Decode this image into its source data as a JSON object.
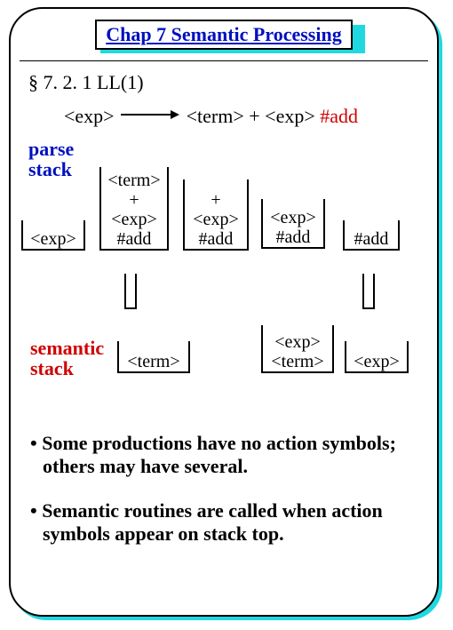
{
  "title": "Chap 7  Semantic Processing",
  "section": "§ 7. 2. 1   LL(1)",
  "production": {
    "lhs": "<exp>",
    "rhs_term": "<term>",
    "rhs_plus": "+",
    "rhs_exp": "<exp>",
    "rhs_action": " #add"
  },
  "labels": {
    "parse_stack_line1": "parse",
    "parse_stack_line2": "stack",
    "semantic_stack_line1": "semantic",
    "semantic_stack_line2": "stack"
  },
  "parse_stacks": {
    "s1": [
      "<exp>"
    ],
    "s2": [
      "<term>",
      "+",
      "<exp>",
      "#add"
    ],
    "s3": [
      "+",
      "<exp>",
      "#add"
    ],
    "s4": [
      "<exp>",
      "#add"
    ],
    "s5": [
      "#add"
    ]
  },
  "semantic_stacks": {
    "t1": [],
    "t2": [
      "<term>"
    ],
    "t3": [
      "<exp>",
      "<term>"
    ],
    "t4": [
      "<exp>"
    ]
  },
  "bullets": {
    "b1": "Some productions have no action symbols; others may have several.",
    "b2": "Semantic routines are called when action symbols appear on stack top."
  }
}
